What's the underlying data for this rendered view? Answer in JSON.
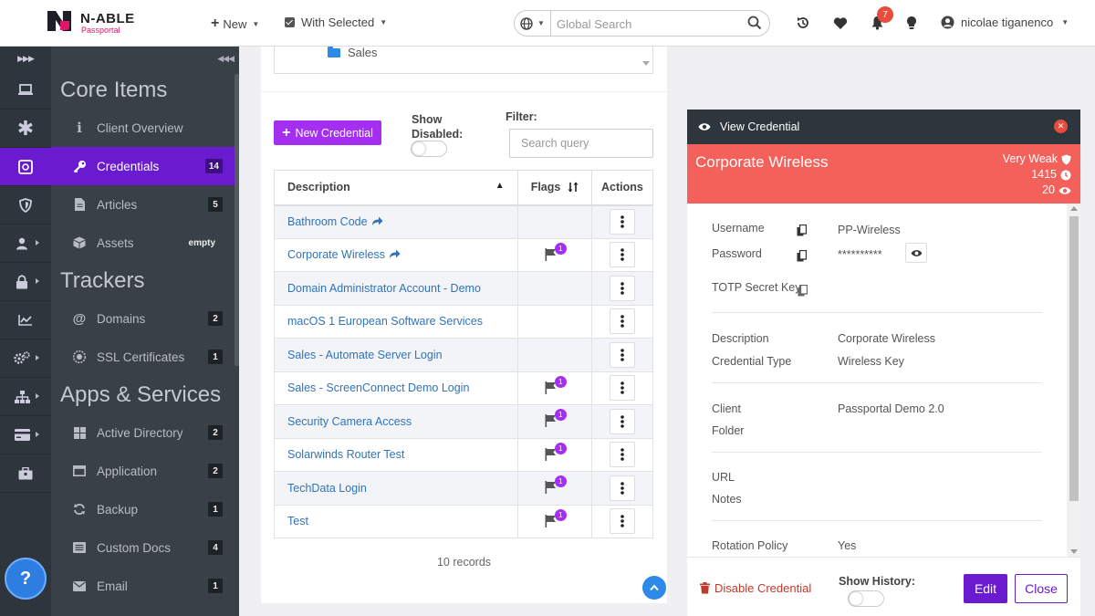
{
  "brand": {
    "name": "N-ABLE",
    "product": "Passportal",
    "accent": "#6a1bd0",
    "brand_pink": "#e0166b"
  },
  "topbar": {
    "new_label": "New",
    "with_selected_label": "With Selected",
    "search_placeholder": "Global Search",
    "notification_count": "7",
    "user_name": "nicolae tiganenco",
    "icons": [
      "globe-icon",
      "search-icon",
      "history-icon",
      "heart-icon",
      "bell-icon",
      "lightbulb-icon",
      "user-circle-icon"
    ]
  },
  "rail": {
    "items": [
      {
        "icon": "laptop-icon",
        "active": false,
        "caret": false
      },
      {
        "icon": "asterisk-icon",
        "active": false,
        "caret": false
      },
      {
        "icon": "vault-icon",
        "active": true,
        "caret": false
      },
      {
        "icon": "shield-icon",
        "active": false,
        "caret": false
      },
      {
        "icon": "users-icon",
        "active": false,
        "caret": true
      },
      {
        "icon": "lock-icon",
        "active": false,
        "caret": true
      },
      {
        "icon": "chart-icon",
        "active": false,
        "caret": false
      },
      {
        "icon": "cogs-icon",
        "active": false,
        "caret": true
      },
      {
        "icon": "sitemap-icon",
        "active": false,
        "caret": true
      },
      {
        "icon": "card-icon",
        "active": false,
        "caret": true
      },
      {
        "icon": "briefcase-icon",
        "active": false,
        "caret": false
      }
    ],
    "help_label": "?"
  },
  "sidebar": {
    "sections": [
      {
        "title": "Core Items",
        "items": [
          {
            "label": "Client Overview",
            "badge": "",
            "icon": "info-icon"
          },
          {
            "label": "Credentials",
            "badge": "14",
            "icon": "key-icon",
            "active": true
          },
          {
            "label": "Articles",
            "badge": "5",
            "icon": "document-icon"
          },
          {
            "label": "Assets",
            "badge": "empty",
            "icon": "cube-icon"
          }
        ]
      },
      {
        "title": "Trackers",
        "items": [
          {
            "label": "Domains",
            "badge": "2",
            "icon": "at-icon"
          },
          {
            "label": "SSL Certificates",
            "badge": "1",
            "icon": "certificate-icon"
          }
        ]
      },
      {
        "title": "Apps & Services",
        "items": [
          {
            "label": "Active Directory",
            "badge": "2",
            "icon": "windows-icon"
          },
          {
            "label": "Application",
            "badge": "2",
            "icon": "window-icon"
          },
          {
            "label": "Backup",
            "badge": "1",
            "icon": "refresh-icon"
          },
          {
            "label": "Custom Docs",
            "badge": "4",
            "icon": "list-icon"
          },
          {
            "label": "Email",
            "badge": "1",
            "icon": "envelope-icon"
          }
        ]
      }
    ]
  },
  "folder": {
    "name": "Sales"
  },
  "list": {
    "new_credential_label": "New Credential",
    "show_disabled_label": "Show Disabled:",
    "filter_label": "Filter:",
    "filter_placeholder": "Search query",
    "columns": {
      "description": "Description",
      "flags": "Flags",
      "actions": "Actions"
    },
    "rows": [
      {
        "description": "Bathroom Code",
        "shared": true,
        "flags": ""
      },
      {
        "description": "Corporate Wireless",
        "shared": true,
        "flags": "1"
      },
      {
        "description": "Domain Administrator Account - Demo",
        "shared": false,
        "flags": ""
      },
      {
        "description": "macOS 1 European Software Services",
        "shared": false,
        "flags": ""
      },
      {
        "description": "Sales - Automate Server Login",
        "shared": false,
        "flags": ""
      },
      {
        "description": "Sales - ScreenConnect Demo Login",
        "shared": false,
        "flags": "1"
      },
      {
        "description": "Security Camera Access",
        "shared": false,
        "flags": "1"
      },
      {
        "description": "Solarwinds Router Test",
        "shared": false,
        "flags": "1"
      },
      {
        "description": "TechData Login",
        "shared": false,
        "flags": "1"
      },
      {
        "description": "Test",
        "shared": false,
        "flags": "1"
      }
    ],
    "records_label": "10 records"
  },
  "view_credential": {
    "header": "View Credential",
    "title": "Corporate Wireless",
    "strength": "Very Weak",
    "age": "1415",
    "views": "20",
    "banner_color": "#f4605a",
    "fields": {
      "username_label": "Username",
      "username_value": "PP-Wireless",
      "password_label": "Password",
      "password_value": "**********",
      "totp_label": "TOTP Secret Key",
      "description_label": "Description",
      "description_value": "Corporate Wireless",
      "type_label": "Credential Type",
      "type_value": "Wireless Key",
      "client_label": "Client",
      "client_value": "Passportal Demo 2.0",
      "folder_label": "Folder",
      "url_label": "URL",
      "notes_label": "Notes",
      "rotation_label": "Rotation Policy",
      "rotation_value": "Yes"
    },
    "footer": {
      "disable_label": "Disable Credential",
      "show_history_label": "Show History:",
      "edit_label": "Edit",
      "close_label": "Close"
    }
  }
}
